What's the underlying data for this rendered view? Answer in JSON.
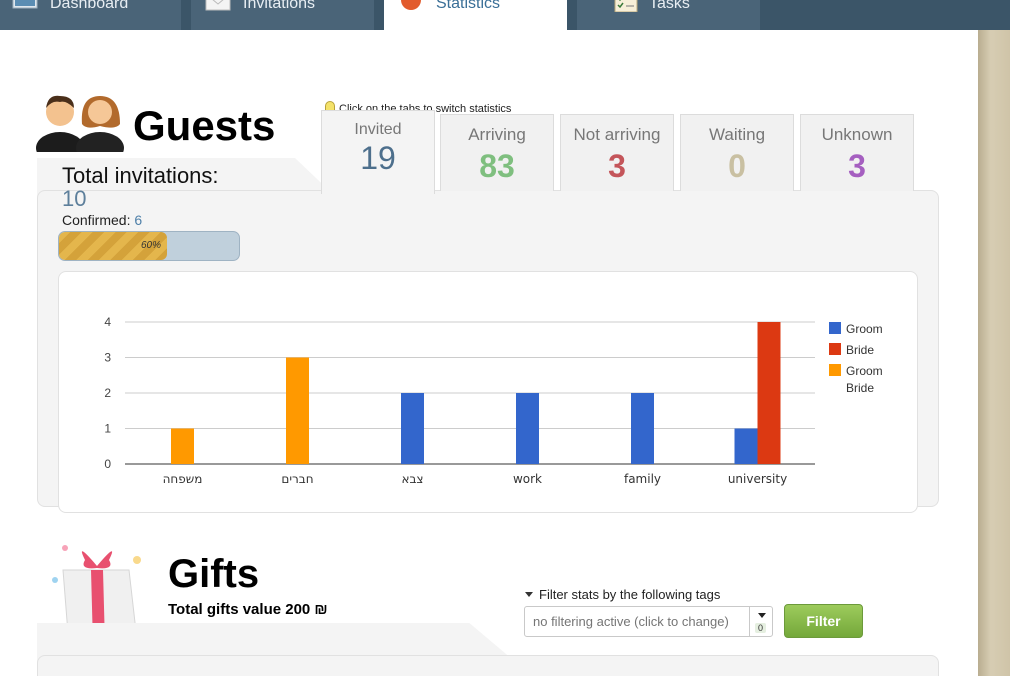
{
  "nav": {
    "tabs": [
      {
        "label": "Dashboard",
        "icon": "monitor-icon"
      },
      {
        "label": "Invitations",
        "icon": "envelope-icon"
      },
      {
        "label": "Statistics",
        "icon": "pie-chart-icon",
        "active": true
      },
      {
        "label": "Tasks",
        "icon": "checklist-icon"
      }
    ]
  },
  "guests": {
    "title": "Guests",
    "tip": "Click on the tabs to switch statistics",
    "total_label": "Total invitations:",
    "total_value": "10",
    "confirmed_label": "Confirmed:",
    "confirmed_value": "6",
    "progress_label": "60%",
    "progress_value": 0.6,
    "stat_tabs": [
      {
        "label": "Invited",
        "value": "19",
        "color": "#4d6f8c"
      },
      {
        "label": "Arriving",
        "value": "83",
        "color": "#7fbf7f"
      },
      {
        "label": "Not arriving",
        "value": "3",
        "color": "#c4555a"
      },
      {
        "label": "Waiting",
        "value": "0",
        "color": "#c9c0a2"
      },
      {
        "label": "Unknown",
        "value": "3",
        "color": "#a55fc0"
      }
    ]
  },
  "chart_data": {
    "type": "bar",
    "categories": [
      "משפחה",
      "חברים",
      "צבא",
      "work",
      "family",
      "university"
    ],
    "series": [
      {
        "name": "Groom",
        "values": [
          0,
          0,
          2,
          2,
          2,
          1
        ],
        "color": "#3366cc"
      },
      {
        "name": "Bride",
        "values": [
          0,
          0,
          0,
          0,
          0,
          4
        ],
        "color": "#dc3912"
      },
      {
        "name": "Groom\nBride",
        "values": [
          1,
          3,
          0,
          0,
          0,
          0
        ],
        "color": "#ff9900"
      }
    ],
    "yticks": [
      "0",
      "1",
      "2",
      "3",
      "4"
    ],
    "ylim": [
      0,
      4
    ],
    "legend_position": "right",
    "grid": true
  },
  "gifts": {
    "title": "Gifts",
    "total": "Total gifts value 200 ₪",
    "filter_label": "Filter stats by the following tags",
    "filter_placeholder": "no filtering active (click to change)",
    "filter_count": "0",
    "filter_button": "Filter"
  }
}
